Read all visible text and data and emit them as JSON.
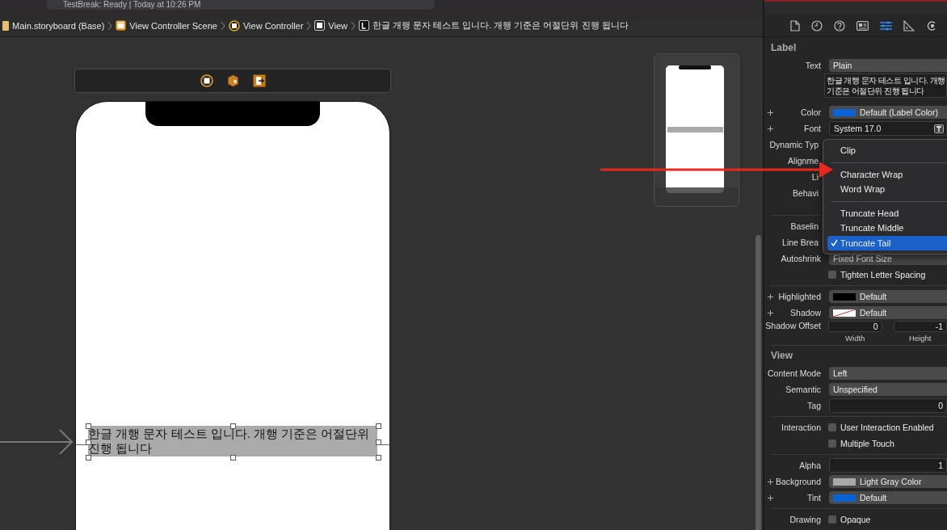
{
  "toolbar": {
    "status": "TestBreak: Ready | Today at 10:26 PM"
  },
  "breadcrumb": [
    {
      "kind": "file",
      "label": "Main.storyboard (Base)"
    },
    {
      "kind": "scene",
      "label": "View Controller Scene"
    },
    {
      "kind": "controller",
      "label": "View Controller"
    },
    {
      "kind": "view",
      "label": "View"
    },
    {
      "kind": "label",
      "label": "한글 개행 문자 테스트 입니다. 개행 기준은 어절단위 진행 됩니다"
    }
  ],
  "canvas": {
    "label_lines": [
      "한글 개행 문자 테스트 입니다. 개행 기준은 어절단위",
      "진행 됩니다"
    ]
  },
  "inspector": {
    "tabs": [
      {
        "kind": "file",
        "selected": false
      },
      {
        "kind": "history",
        "selected": false
      },
      {
        "kind": "help",
        "selected": false
      },
      {
        "kind": "identity",
        "selected": false
      },
      {
        "kind": "attributes",
        "selected": true
      },
      {
        "kind": "size",
        "selected": false
      },
      {
        "kind": "connections",
        "selected": false
      }
    ],
    "sections": [
      {
        "title": "Label",
        "rows": [
          {
            "kind": "popup",
            "label": "Text",
            "value": "Plain"
          },
          {
            "kind": "textarea",
            "lines": [
              "한글 개행 문자 테스트 입니다. 개행",
              "기준은 어절단위 진행 됩니다"
            ]
          },
          {
            "kind": "popup",
            "label": "Color",
            "value": "Default (Label Color)",
            "plus": true,
            "swatch": {
              "kind": "solid",
              "color": "#0a63d6"
            }
          },
          {
            "kind": "font",
            "label": "Font",
            "value": "System 17.0",
            "plus": true
          },
          {
            "kind": "label_only",
            "label": "Dynamic Typ"
          },
          {
            "kind": "label_only",
            "label": "Alignme"
          },
          {
            "kind": "label_only",
            "label": "Li"
          },
          {
            "kind": "label_only",
            "label": "Behavi",
            "divider_after": true
          },
          {
            "kind": "label_only",
            "label": "Baselin"
          },
          {
            "kind": "label_only",
            "label": "Line Brea"
          },
          {
            "kind": "popup",
            "label": "Autoshrink",
            "value": "Fixed Font Size"
          },
          {
            "kind": "checkbox",
            "text": "Tighten Letter Spacing",
            "checked": false,
            "divider_after": true
          },
          {
            "kind": "popup",
            "label": "Highlighted",
            "value": "Default",
            "plus": true,
            "swatch": {
              "kind": "solid",
              "color": "#000000"
            }
          },
          {
            "kind": "popup",
            "label": "Shadow",
            "value": "Default",
            "plus": true,
            "swatch": {
              "kind": "cleared"
            }
          },
          {
            "kind": "pair",
            "label": "Shadow Offset",
            "values": [
              "0",
              "-1"
            ],
            "captions": [
              "Width",
              "Height"
            ],
            "divider_after": true
          }
        ]
      },
      {
        "title": "View",
        "rows": [
          {
            "kind": "popup",
            "label": "Content Mode",
            "value": "Left"
          },
          {
            "kind": "popup",
            "label": "Semantic",
            "value": "Unspecified"
          },
          {
            "kind": "number",
            "label": "Tag",
            "value": "0",
            "divider_after": true
          },
          {
            "kind": "checkbox",
            "label": "Interaction",
            "text": "User Interaction Enabled",
            "checked": false
          },
          {
            "kind": "checkbox",
            "text": "Multiple Touch",
            "checked": false,
            "divider_after": true
          },
          {
            "kind": "number",
            "label": "Alpha",
            "value": "1"
          },
          {
            "kind": "popup",
            "label": "Background",
            "value": "Light Gray Color",
            "plus": true,
            "swatch": {
              "kind": "solid",
              "color": "#a9a9a9"
            }
          },
          {
            "kind": "popup",
            "label": "Tint",
            "value": "Default",
            "plus": true,
            "swatch": {
              "kind": "solid",
              "color": "#0a63d6"
            },
            "divider_after": true
          },
          {
            "kind": "checkbox",
            "label": "Drawing",
            "text": "Opaque",
            "checked": false
          }
        ]
      }
    ]
  },
  "popup_menu": [
    {
      "kind": "item",
      "label": "Clip",
      "selected": false
    },
    {
      "kind": "separator"
    },
    {
      "kind": "item",
      "label": "Character Wrap",
      "selected": false
    },
    {
      "kind": "item",
      "label": "Word Wrap",
      "selected": false
    },
    {
      "kind": "separator"
    },
    {
      "kind": "item",
      "label": "Truncate Head",
      "selected": false
    },
    {
      "kind": "item",
      "label": "Truncate Middle",
      "selected": false
    },
    {
      "kind": "item",
      "label": "Truncate Tail",
      "selected": true
    }
  ]
}
